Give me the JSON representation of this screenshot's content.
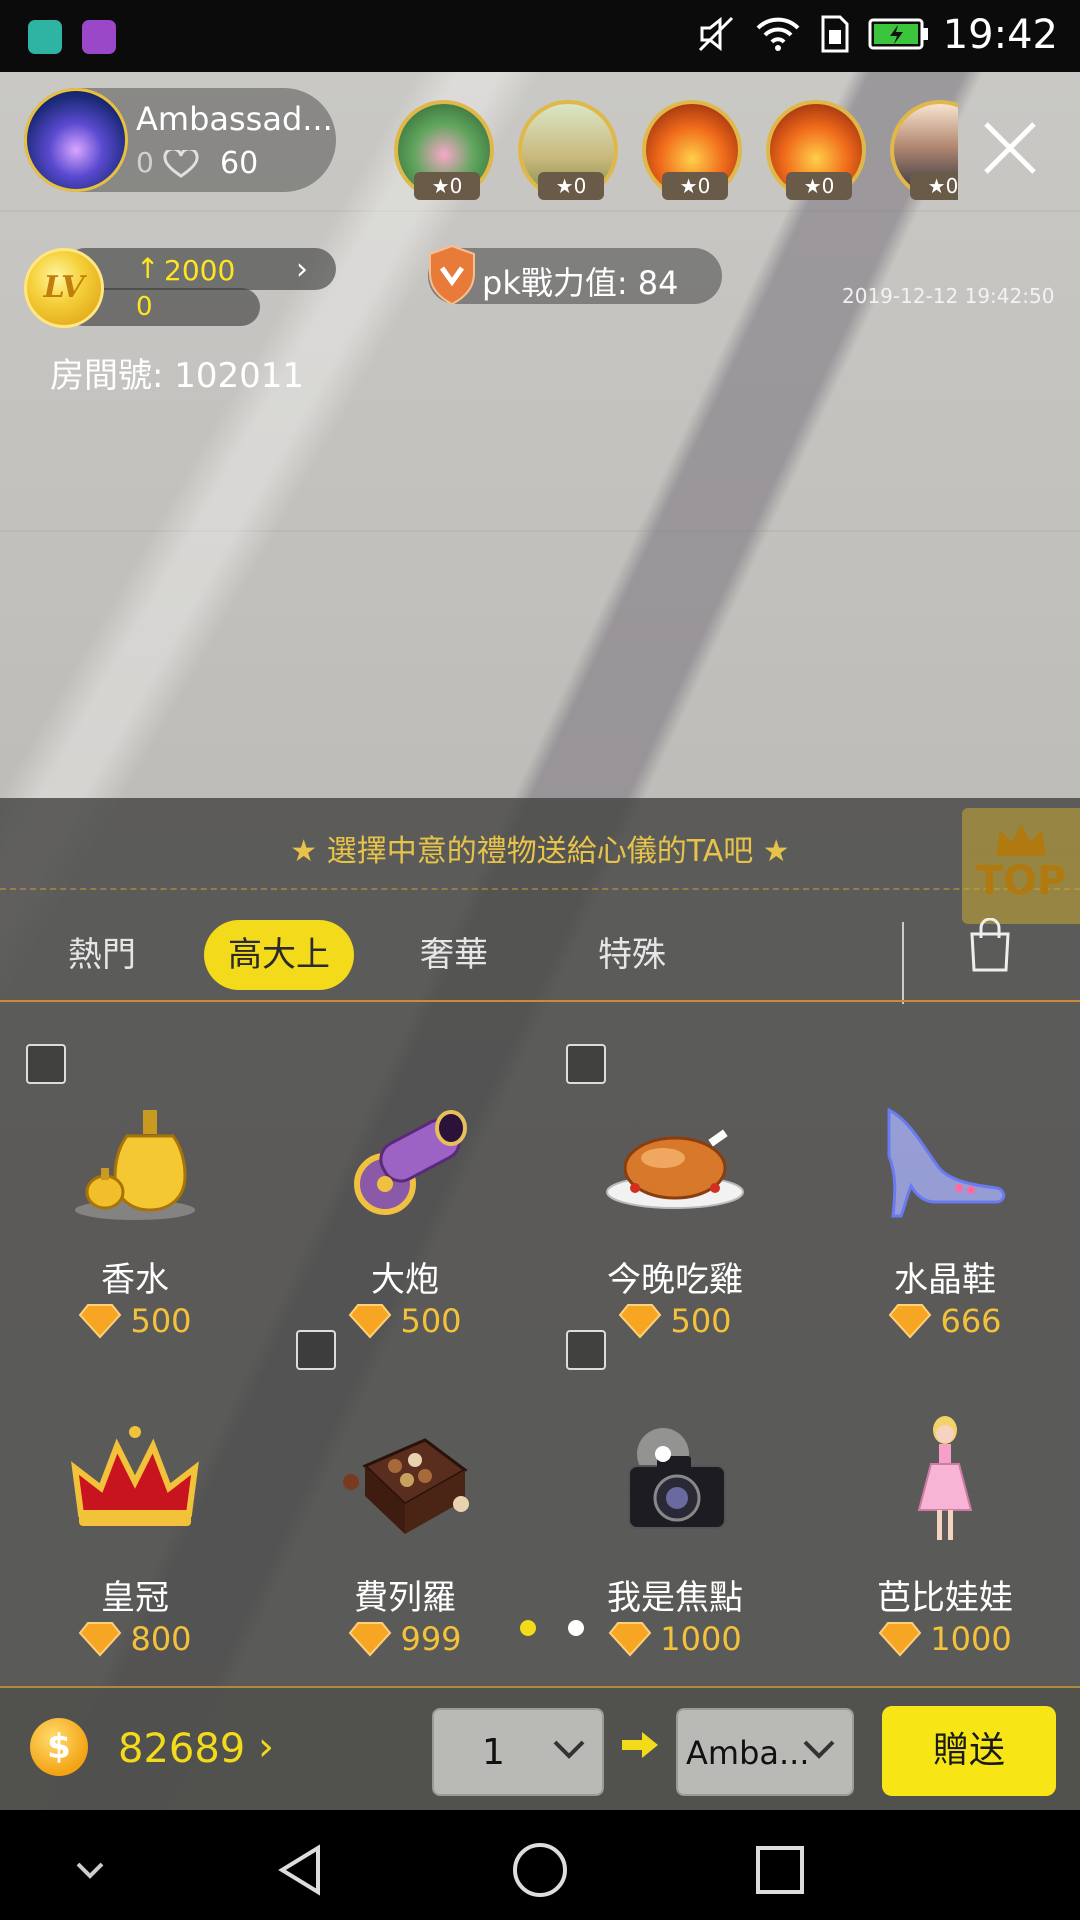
{
  "status_bar": {
    "time": "19:42",
    "icons": [
      "android-icon",
      "gallery-icon",
      "mute-icon",
      "wifi-icon",
      "sim-icon",
      "battery-charging-icon"
    ]
  },
  "host": {
    "name": "Ambassad...",
    "hearts_count": "0",
    "fans_count": "60"
  },
  "viewers": [
    {
      "badge": "0",
      "theme": "lotus"
    },
    {
      "badge": "0",
      "theme": "field"
    },
    {
      "badge": "0",
      "theme": "sunset"
    },
    {
      "badge": "0",
      "theme": "sunset"
    },
    {
      "badge": "0",
      "theme": "city"
    }
  ],
  "level": {
    "value": "2000",
    "sub_value": "0",
    "badge_text": "LV"
  },
  "pk": {
    "label": "pk戰力值: 84"
  },
  "timestamp": "2019-12-12 19:42:50",
  "room": {
    "label": "房間號: 102011"
  },
  "gift_panel": {
    "hint": "★ 選擇中意的禮物送給心儀的TA吧 ★",
    "top_label": "TOP",
    "tabs": [
      {
        "label": "熱門",
        "active": false
      },
      {
        "label": "高大上",
        "active": true
      },
      {
        "label": "奢華",
        "active": false
      },
      {
        "label": "特殊",
        "active": false
      }
    ],
    "gifts": [
      {
        "name": "香水",
        "price": "500",
        "tagged": true,
        "icon": "perfume-icon"
      },
      {
        "name": "大炮",
        "price": "500",
        "tagged": false,
        "icon": "cannon-icon"
      },
      {
        "name": "今晚吃雞",
        "price": "500",
        "tagged": true,
        "icon": "roast-chicken-icon"
      },
      {
        "name": "水晶鞋",
        "price": "666",
        "tagged": false,
        "icon": "crystal-shoe-icon"
      },
      {
        "name": "皇冠",
        "price": "800",
        "tagged": false,
        "icon": "crown-icon"
      },
      {
        "name": "費列羅",
        "price": "999",
        "tagged": true,
        "icon": "chocolate-box-icon"
      },
      {
        "name": "我是焦點",
        "price": "1000",
        "tagged": true,
        "icon": "camera-icon"
      },
      {
        "name": "芭比娃娃",
        "price": "1000",
        "tagged": false,
        "icon": "barbie-doll-icon"
      }
    ],
    "page_count": 2,
    "active_page": 0
  },
  "bottom": {
    "balance": "82689",
    "quantity": "1",
    "recipient": "Amba...",
    "send_label": "贈送"
  },
  "colors": {
    "accent_yellow": "#f3da1a",
    "price_gold": "#f3c23a",
    "hint_gold": "#e8c34a"
  }
}
